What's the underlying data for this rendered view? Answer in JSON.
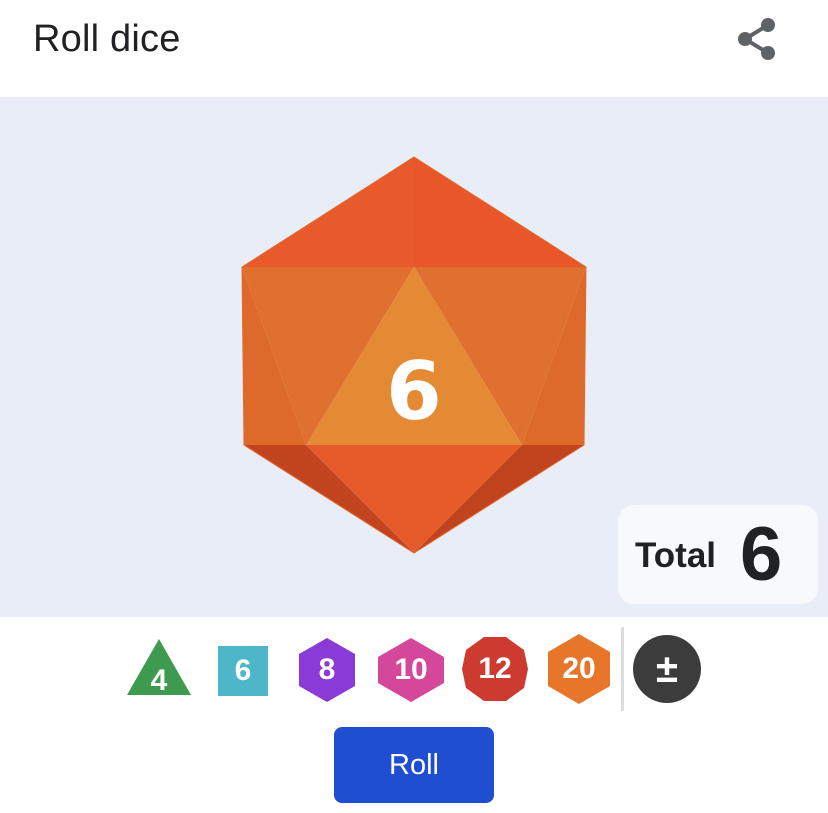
{
  "header": {
    "title": "Roll dice",
    "share_icon": "share-icon"
  },
  "result": {
    "die_type": "d20",
    "die_color": "#e8562a",
    "rolled_value": "6",
    "total_label": "Total",
    "total_value": "6"
  },
  "dice_selector": [
    {
      "label": "4",
      "shape": "triangle",
      "color": "#3d9a4f"
    },
    {
      "label": "6",
      "shape": "square",
      "color": "#4db6c8"
    },
    {
      "label": "8",
      "shape": "hexagon",
      "color": "#8a3ad6"
    },
    {
      "label": "10",
      "shape": "diamond-hexagon",
      "color": "#d4479a"
    },
    {
      "label": "12",
      "shape": "decagon",
      "color": "#cc3a30"
    },
    {
      "label": "20",
      "shape": "hexagon",
      "color": "#e8762a"
    },
    {
      "label": "±",
      "shape": "circle",
      "color": "#3c3c3c",
      "icon": "plus-minus-icon"
    }
  ],
  "actions": {
    "roll_label": "Roll",
    "roll_color": "#1f4fd0"
  }
}
